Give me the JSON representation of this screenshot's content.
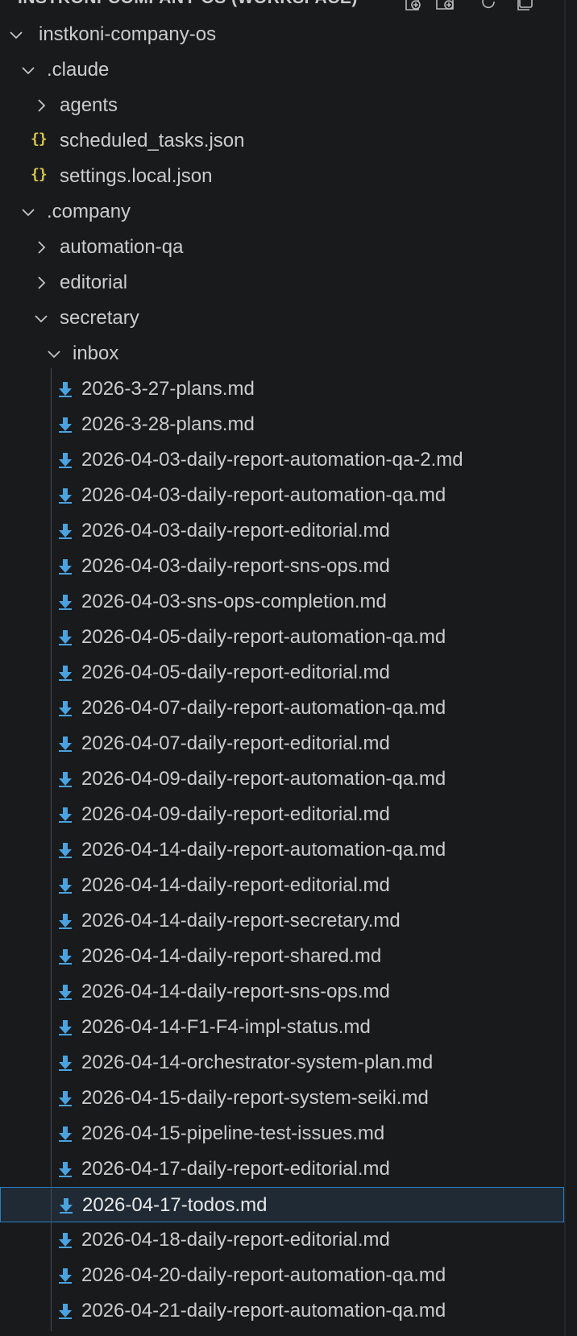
{
  "header": {
    "title": "INSTKONI-COMPANY-OS (WORKSPACE)",
    "actions": [
      {
        "icon": "new-file-icon"
      },
      {
        "icon": "new-folder-icon"
      },
      {
        "icon": "refresh-icon"
      },
      {
        "icon": "collapse-all-icon"
      }
    ]
  },
  "tree": {
    "root": {
      "label": "instkoni-company-os",
      "expanded": true
    },
    "claude_folder": {
      "label": ".claude",
      "expanded": true
    },
    "agents_folder": {
      "label": "agents",
      "expanded": false
    },
    "scheduled_tasks": {
      "label": "scheduled_tasks.json",
      "icon": "{}"
    },
    "settings_local": {
      "label": "settings.local.json",
      "icon": "{}"
    },
    "company_folder": {
      "label": ".company",
      "expanded": true
    },
    "automation_qa_folder": {
      "label": "automation-qa",
      "expanded": false
    },
    "editorial_folder": {
      "label": "editorial",
      "expanded": false
    },
    "secretary_folder": {
      "label": "secretary",
      "expanded": true
    },
    "inbox_folder": {
      "label": "inbox",
      "expanded": true
    },
    "inbox_files": [
      {
        "label": "2026-3-27-plans.md"
      },
      {
        "label": "2026-3-28-plans.md"
      },
      {
        "label": "2026-04-03-daily-report-automation-qa-2.md"
      },
      {
        "label": "2026-04-03-daily-report-automation-qa.md"
      },
      {
        "label": "2026-04-03-daily-report-editorial.md"
      },
      {
        "label": "2026-04-03-daily-report-sns-ops.md"
      },
      {
        "label": "2026-04-03-sns-ops-completion.md"
      },
      {
        "label": "2026-04-05-daily-report-automation-qa.md"
      },
      {
        "label": "2026-04-05-daily-report-editorial.md"
      },
      {
        "label": "2026-04-07-daily-report-automation-qa.md"
      },
      {
        "label": "2026-04-07-daily-report-editorial.md"
      },
      {
        "label": "2026-04-09-daily-report-automation-qa.md"
      },
      {
        "label": "2026-04-09-daily-report-editorial.md"
      },
      {
        "label": "2026-04-14-daily-report-automation-qa.md"
      },
      {
        "label": "2026-04-14-daily-report-editorial.md"
      },
      {
        "label": "2026-04-14-daily-report-secretary.md"
      },
      {
        "label": "2026-04-14-daily-report-shared.md"
      },
      {
        "label": "2026-04-14-daily-report-sns-ops.md"
      },
      {
        "label": "2026-04-14-F1-F4-impl-status.md"
      },
      {
        "label": "2026-04-14-orchestrator-system-plan.md"
      },
      {
        "label": "2026-04-15-daily-report-system-seiki.md"
      },
      {
        "label": "2026-04-15-pipeline-test-issues.md"
      },
      {
        "label": "2026-04-17-daily-report-editorial.md"
      },
      {
        "label": "2026-04-17-todos.md",
        "selected": true
      },
      {
        "label": "2026-04-18-daily-report-editorial.md"
      },
      {
        "label": "2026-04-20-daily-report-automation-qa.md"
      },
      {
        "label": "2026-04-21-daily-report-automation-qa.md"
      }
    ]
  },
  "colors": {
    "background": "#181a1c",
    "text": "#cccccc",
    "json_icon": "#d8c74d",
    "md_icon": "#4aa3e0",
    "selection_border": "#2a7fc1"
  }
}
